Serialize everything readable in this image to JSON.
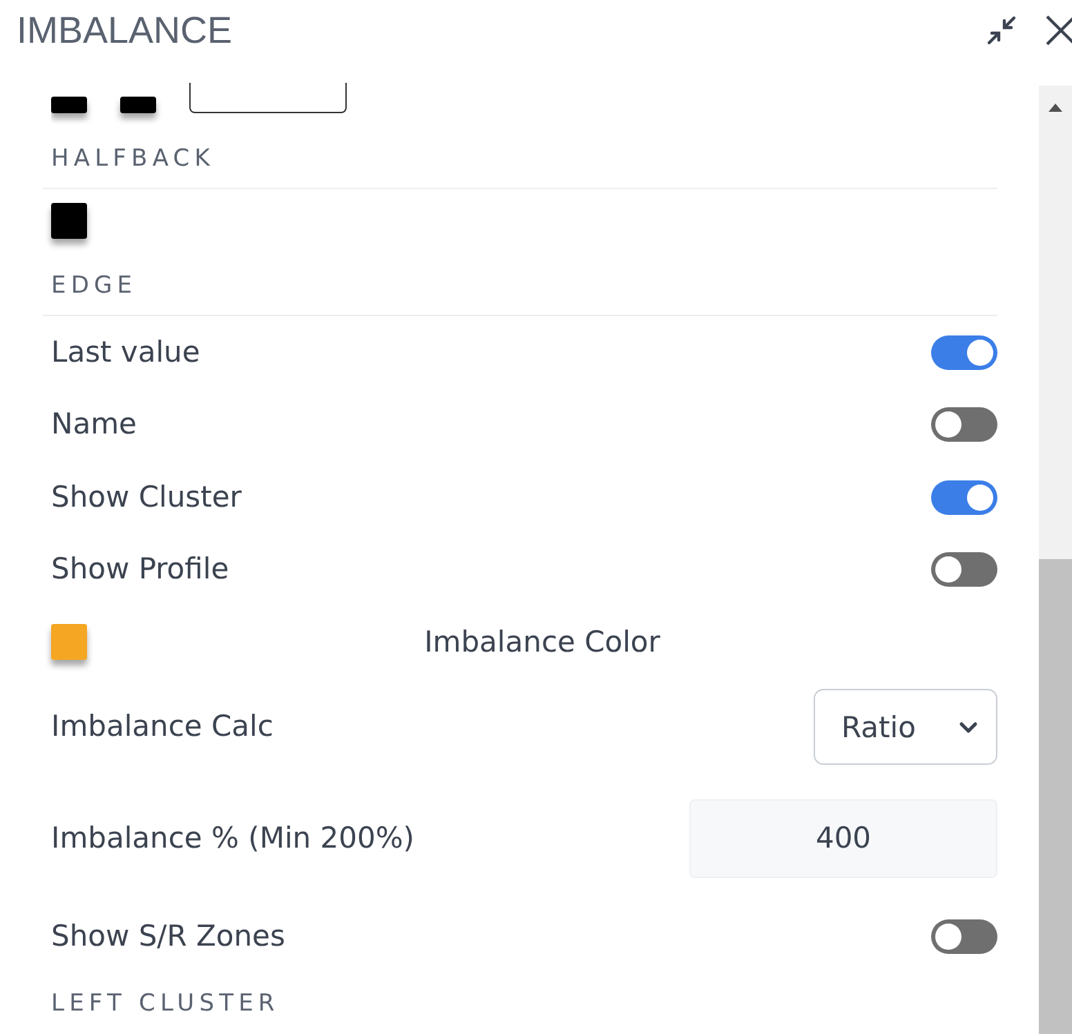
{
  "panel": {
    "title": "IMBALANCE"
  },
  "items": [
    {
      "kind": "swatches",
      "colors": [
        {
          "color": "#000000"
        },
        {
          "color": "#000000"
        }
      ],
      "field": true
    },
    {
      "kind": "heading",
      "label": "HALFBACK"
    },
    {
      "kind": "swatches",
      "colors": [
        {
          "color": "#000000"
        }
      ],
      "field": false
    },
    {
      "kind": "heading",
      "label": "EDGE"
    },
    {
      "kind": "toggle",
      "label": "Last value",
      "on": true
    },
    {
      "kind": "toggle",
      "label": "Name",
      "on": false
    },
    {
      "kind": "toggle",
      "label": "Show Cluster",
      "on": true
    },
    {
      "kind": "toggle",
      "label": "Show Profile",
      "on": false
    },
    {
      "kind": "color",
      "label": "Imbalance Color",
      "color": "#f5a623"
    },
    {
      "kind": "select",
      "label": "Imbalance Calc",
      "value": "Ratio"
    },
    {
      "kind": "number",
      "label": "Imbalance % (Min 200%)",
      "value": "400"
    },
    {
      "kind": "toggle",
      "label": "Show S/R Zones",
      "on": false
    },
    {
      "kind": "heading",
      "label": "LEFT CLUSTER"
    }
  ]
}
